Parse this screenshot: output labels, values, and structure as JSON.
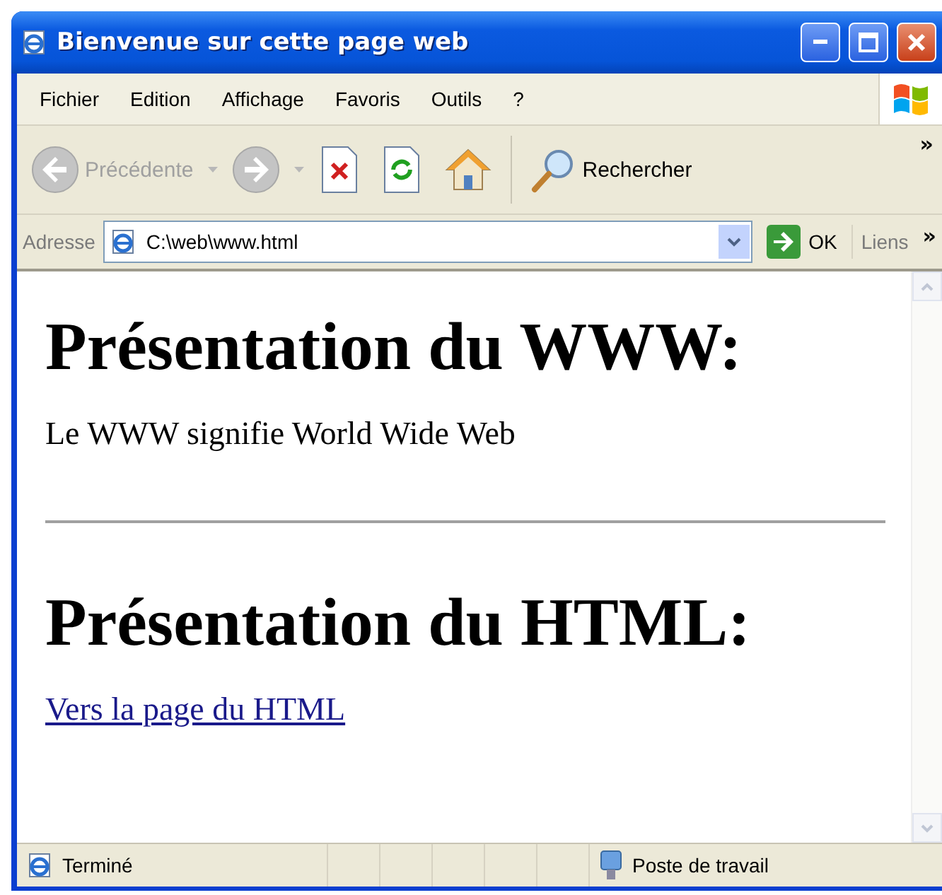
{
  "window": {
    "title": "Bienvenue sur cette page web"
  },
  "menu": [
    {
      "label": "Fichier"
    },
    {
      "label": "Edition"
    },
    {
      "label": "Affichage"
    },
    {
      "label": "Favoris"
    },
    {
      "label": "Outils"
    },
    {
      "label": "?"
    }
  ],
  "toolbar": {
    "buttons": [
      {
        "kind": "back",
        "label": "Précédente",
        "disabled": true
      },
      {
        "kind": "forward",
        "disabled": true
      },
      {
        "kind": "stop"
      },
      {
        "kind": "refresh"
      },
      {
        "kind": "home"
      },
      {
        "kind": "search",
        "label": "Rechercher"
      }
    ],
    "overflow": "»"
  },
  "address_bar": {
    "label": "Adresse",
    "value": "C:\\web\\www.html",
    "go": "OK",
    "links": "Liens",
    "overflow": "»"
  },
  "page": {
    "blocks": [
      {
        "kind": "heading",
        "text": "Présentation du WWW:"
      },
      {
        "kind": "paragraph",
        "text": "Le WWW signifie World Wide Web"
      },
      {
        "kind": "rule"
      },
      {
        "kind": "heading",
        "text": "Présentation du HTML:"
      },
      {
        "kind": "link",
        "text": "Vers la page du HTML"
      }
    ]
  },
  "status_bar": {
    "text": "Terminé",
    "zone": "Poste de travail"
  }
}
